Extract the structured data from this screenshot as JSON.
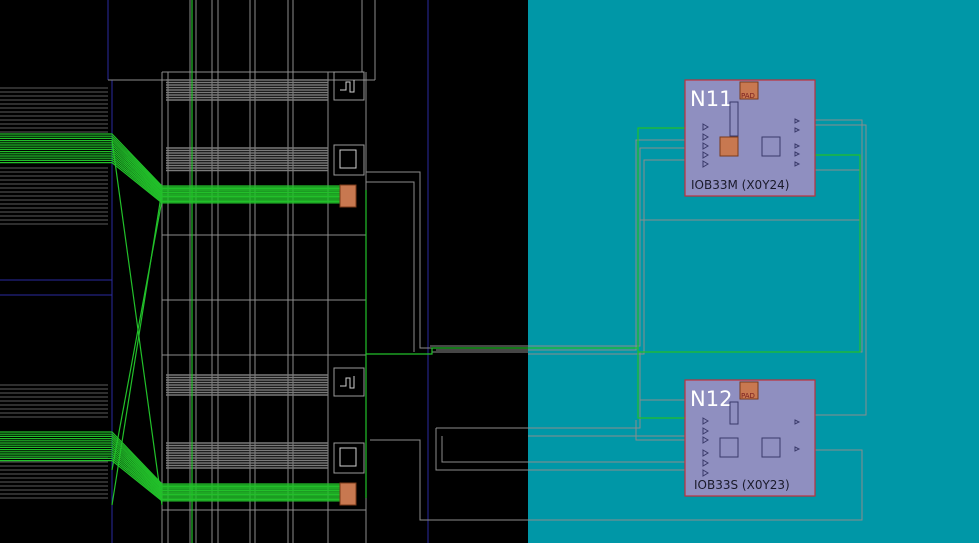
{
  "view": {
    "background": "#000000",
    "region_fill": "#0097a7",
    "route_green": "#22c02a",
    "route_grey": "#8c8c8c",
    "block_border": "#c0303a",
    "block_fill": "#8f8fc0",
    "pad_fill": "#c87850"
  },
  "iob_sites": [
    {
      "pin": "N11",
      "pad_label": "PAD",
      "site": "IOB33M (X0Y24)"
    },
    {
      "pin": "N12",
      "pad_label": "PAD",
      "site": "IOB33S (X0Y23)"
    }
  ]
}
